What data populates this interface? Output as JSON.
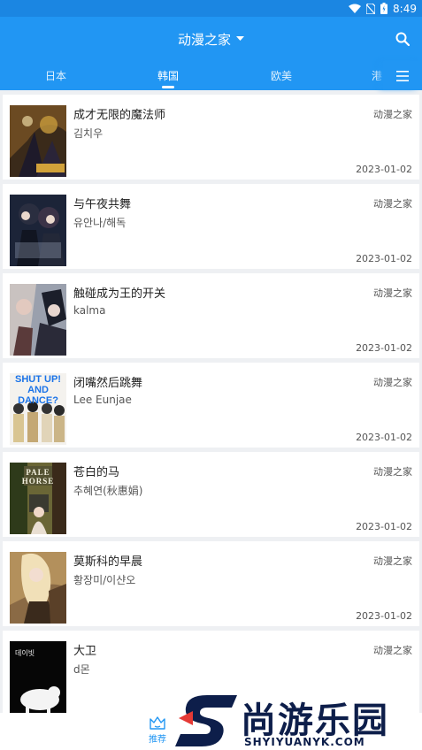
{
  "status_bar": {
    "time": "8:49",
    "icons": [
      "wifi-icon",
      "no-sim-icon",
      "battery-icon"
    ]
  },
  "toolbar": {
    "title": "动漫之家",
    "title_dropdown_icon": "caret-down-icon",
    "search_icon": "search-icon"
  },
  "tabs": {
    "items": [
      {
        "label": "日本"
      },
      {
        "label": "韩国"
      },
      {
        "label": "欧美"
      },
      {
        "label": "港"
      }
    ],
    "active": "韩国",
    "menu_icon": "menu-icon"
  },
  "list": {
    "items": [
      {
        "title": "成才无限的魔法师",
        "author": "김치우",
        "source": "动漫之家",
        "date": "2023-01-02"
      },
      {
        "title": "与午夜共舞",
        "author": "유안나/해독",
        "source": "动漫之家",
        "date": "2023-01-02"
      },
      {
        "title": "触碰成为王的开关",
        "author": "kalma",
        "source": "动漫之家",
        "date": "2023-01-02"
      },
      {
        "title": "闭嘴然后跳舞",
        "author": "Lee Eunjae",
        "source": "动漫之家",
        "date": "2023-01-02",
        "cover_text": [
          "SHUT UP!",
          "AND",
          "DANCE?"
        ]
      },
      {
        "title": "苍白的马",
        "author": "추혜연(秋惠娟)",
        "source": "动漫之家",
        "date": "2023-01-02",
        "cover_text": [
          "PALE",
          "HORSE"
        ]
      },
      {
        "title": "莫斯科的早晨",
        "author": "황장미/이샨오",
        "source": "动漫之家",
        "date": "2023-01-02"
      },
      {
        "title": "大卫",
        "author": "d몬",
        "source": "动漫之家",
        "date": "",
        "cover_text": [
          "데이빗"
        ]
      }
    ]
  },
  "bottom_nav": {
    "items": [
      {
        "label": "推荐",
        "icon": "crown-icon"
      }
    ]
  },
  "watermark": {
    "text_cn": "尚游乐园",
    "text_en": "SHYIYUANYK.COM"
  },
  "colors": {
    "primary": "#2196f3",
    "status_bar": "#1b86e2",
    "background": "#eef0f3",
    "watermark": "#0d1e4a"
  }
}
